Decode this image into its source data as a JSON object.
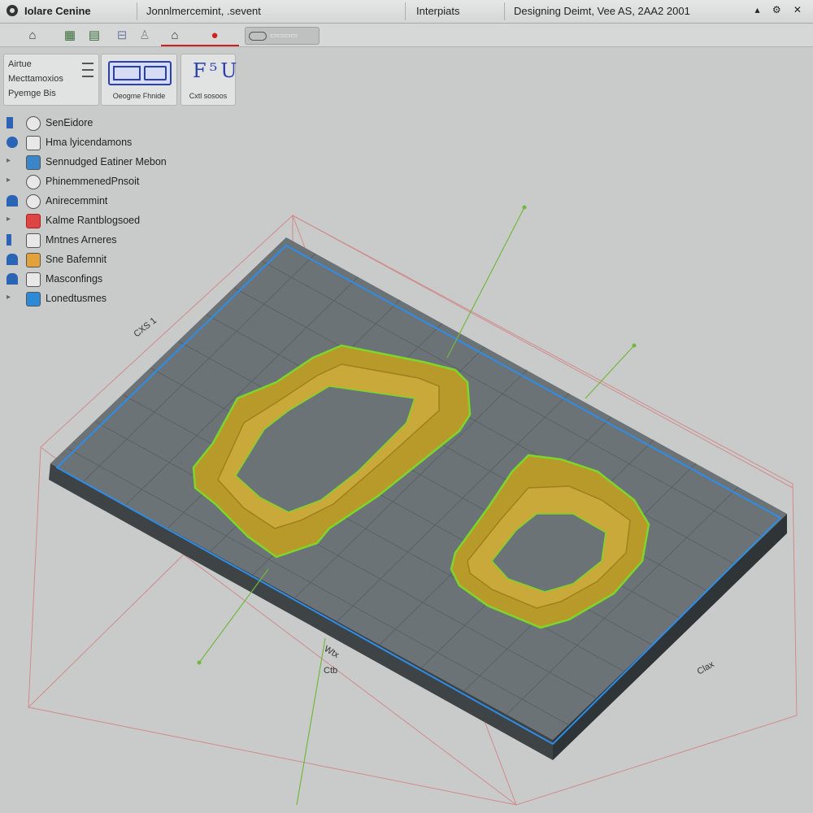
{
  "titlebar": {
    "app_name": "Iolare Cenine",
    "document": "Jonnlmercemint, .sevent",
    "section": "Interpiats",
    "status": "Designing Deimt, Vee AS, 2AA2 2001",
    "controls": "▴ ⚙ ✕"
  },
  "toolbar": {
    "buttons": [
      {
        "icon": "home-icon",
        "glyph": "⌂"
      },
      {
        "icon": "grid-icon",
        "glyph": "▦"
      },
      {
        "icon": "layer-icon",
        "glyph": "▤"
      },
      {
        "icon": "frame-icon",
        "glyph": "⊟"
      },
      {
        "icon": "figure-icon",
        "glyph": "♙"
      },
      {
        "icon": "house-icon",
        "glyph": "⌂"
      },
      {
        "icon": "pin-icon",
        "glyph": "●"
      }
    ],
    "field_label": "▭▭▭▭"
  },
  "ribbon": {
    "list_items": [
      "Airtue",
      "Mecttamoxios",
      "Pyemge Bis"
    ],
    "group_a_label": "Oeogme Fhnide",
    "group_b_glyph": "F⁵U",
    "group_b_label": "Cxtl sosoos"
  },
  "tree": {
    "items": [
      {
        "label": "SenEidore",
        "icon": "document-icon"
      },
      {
        "label": "Hma lyicendamons",
        "icon": "camera-icon"
      },
      {
        "label": "Sennudged Eatiner Mebon",
        "icon": "image-icon"
      },
      {
        "label": "PhinemmenedPnsoit",
        "icon": "target-icon"
      },
      {
        "label": "Anirecemmint",
        "icon": "gear-icon"
      },
      {
        "label": "Kalme Rantblogsoed",
        "icon": "folder-icon"
      },
      {
        "label": "Mntnes Arneres",
        "icon": "list-icon"
      },
      {
        "label": "Sne Bafemnit",
        "icon": "box-icon"
      },
      {
        "label": "Masconfings",
        "icon": "settings-icon"
      },
      {
        "label": "Lonedtusmes",
        "icon": "cube-icon"
      }
    ]
  },
  "viewport": {
    "dimension_labels": [
      "CXS 1",
      "Wtx",
      "Ctb",
      "Clax"
    ]
  },
  "colors": {
    "plate_top": "#6c7376",
    "plate_side": "#3e4346",
    "part": "#b89a2a",
    "part_edge": "#7dd62a",
    "axis_line": "#72b83c",
    "selection_edge": "#2e8de8",
    "bound_box": "#d85656",
    "accent_underline": "#d01f1f"
  }
}
